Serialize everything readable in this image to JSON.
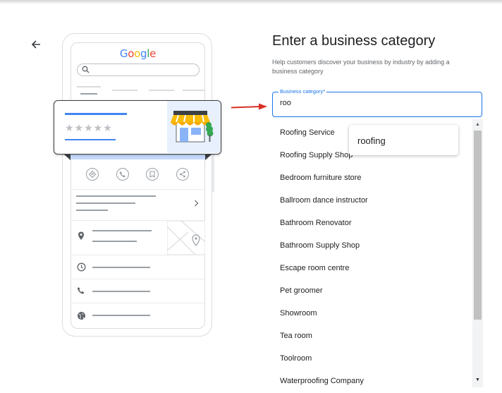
{
  "header": {
    "back_icon": "arrow-left-icon"
  },
  "illustration": {
    "logo_letters": [
      {
        "ch": "G",
        "color": "#4285F4"
      },
      {
        "ch": "o",
        "color": "#EA4335"
      },
      {
        "ch": "o",
        "color": "#FBBC05"
      },
      {
        "ch": "g",
        "color": "#4285F4"
      },
      {
        "ch": "l",
        "color": "#34A853"
      },
      {
        "ch": "e",
        "color": "#EA4335"
      }
    ],
    "stars": "★★★★★",
    "accent_color": "#4285F4",
    "arrow_color": "#D93025"
  },
  "form": {
    "title": "Enter a business category",
    "description": "Help customers discover your business by industry by adding a business category",
    "field_label": "Business category*",
    "field_value": "roo"
  },
  "options": [
    "Roofing Service",
    "Roofing Supply Shop",
    "Bedroom furniture store",
    "Ballroom dance instructor",
    "Bathroom Renovator",
    "Bathroom Supply Shop",
    "Escape room centre",
    "Pet groomer",
    "Showroom",
    "Tea room",
    "Toolroom",
    "Waterproofing Company"
  ],
  "suggestion": "roofing",
  "colors": {
    "primary": "#1A73E8",
    "text": "#202124",
    "muted": "#5F6368"
  }
}
